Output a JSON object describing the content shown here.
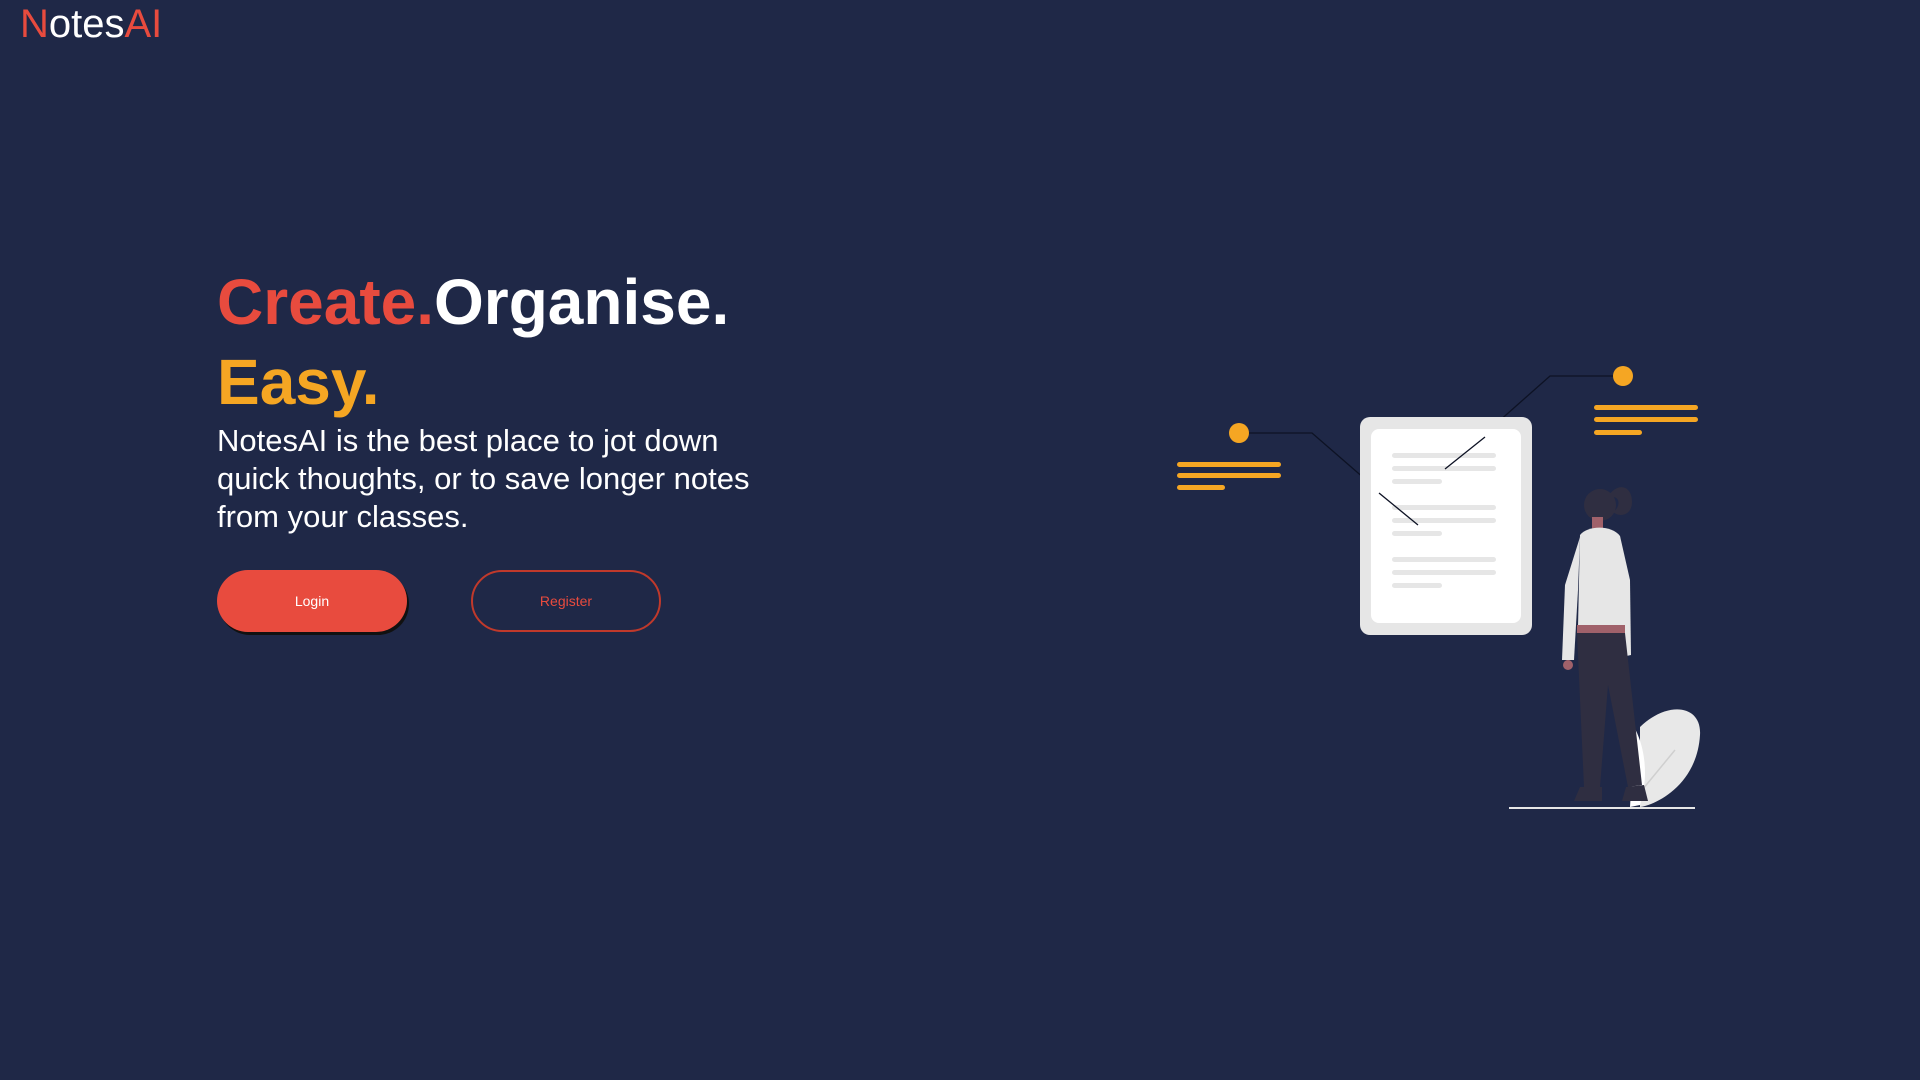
{
  "brand": {
    "logo_first": "N",
    "logo_middle": "otes",
    "logo_last": "AI",
    "accent_color": "#e84b3e",
    "secondary_color": "#f5a623",
    "background_color": "#1f2847"
  },
  "hero": {
    "word1": "Create.",
    "word2": "Organise.",
    "word3": "Easy.",
    "tagline": "NotesAI is the best place to jot down quick thoughts, or to save longer notes from your classes."
  },
  "buttons": {
    "login_label": "Login",
    "register_label": "Register"
  },
  "illustration": {
    "icon": "woman-viewing-document-illustration"
  }
}
